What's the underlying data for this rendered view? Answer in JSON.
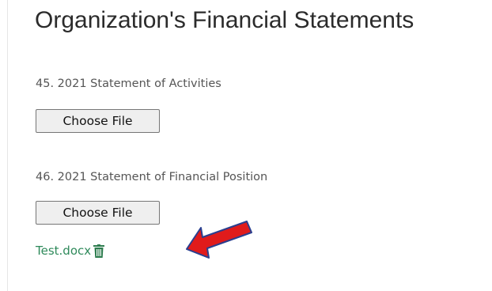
{
  "section": {
    "title": "Organization's Financial Statements"
  },
  "fields": [
    {
      "label": "45. 2021 Statement of Activities",
      "button_label": "Choose File"
    },
    {
      "label": "46. 2021 Statement of Financial Position",
      "button_label": "Choose File",
      "uploaded_file": "Test.docx"
    }
  ],
  "icons": {
    "delete": "trash-icon",
    "annotation": "red-arrow-icon"
  },
  "colors": {
    "file_link": "#2f8a5b",
    "trash_icon": "#2e7d4f",
    "arrow_fill": "#e01b1b",
    "arrow_outline": "#2a3f8f"
  }
}
